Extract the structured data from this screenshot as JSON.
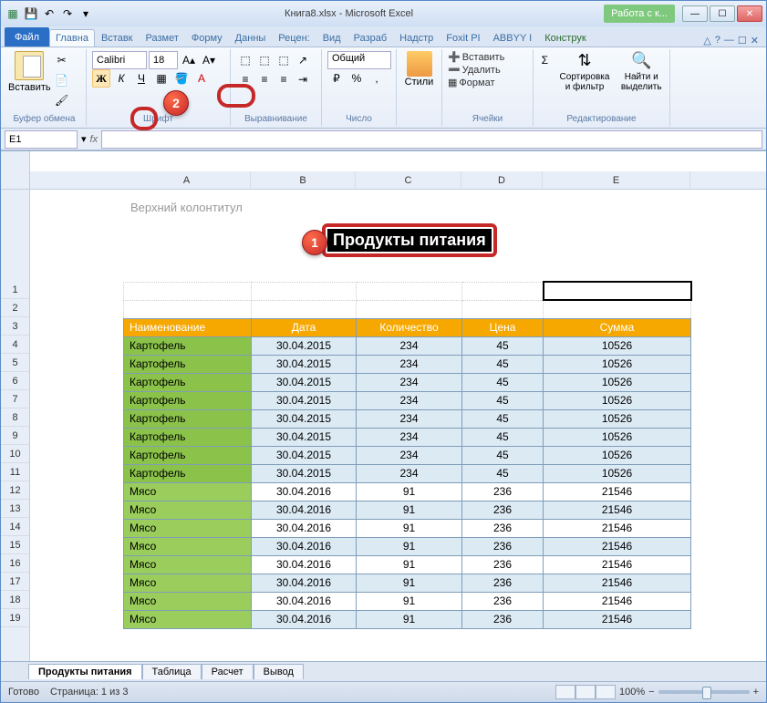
{
  "window": {
    "title": "Книга8.xlsx - Microsoft Excel",
    "context_tab": "Работа с к..."
  },
  "qat": {
    "save": "💾",
    "undo": "↶",
    "redo": "↷"
  },
  "win_btns": {
    "min": "—",
    "max": "☐",
    "close": "✕"
  },
  "ribbon": {
    "tabs": [
      "Файл",
      "Главна",
      "Вставк",
      "Размет",
      "Форму",
      "Данны",
      "Рецен:",
      "Вид",
      "Разраб",
      "Надстр",
      "Foxit PI",
      "ABBYY I",
      "Конструк"
    ],
    "help": {
      "q": "?",
      "up": "△",
      "sub_min": "—",
      "sub_max": "☐",
      "sub_close": "✕"
    },
    "groups": {
      "clipboard": "Буфер обмена",
      "font": "Шрифт",
      "align": "Выравнивание",
      "number": "Число",
      "styles": "Стили",
      "cells": "Ячейки",
      "editing": "Редактирование"
    },
    "paste": "Вставить",
    "font_name": "Calibri",
    "font_size": "18",
    "bold": "Ж",
    "italic": "К",
    "underline": "Ч",
    "number_format": "Общий",
    "cells_insert": "Вставить",
    "cells_delete": "Удалить",
    "cells_format": "Формат",
    "sort": "Сортировка и фильтр",
    "find": "Найти и выделить"
  },
  "namebox": "E1",
  "fx": "fx",
  "cols": [
    "A",
    "B",
    "C",
    "D",
    "E"
  ],
  "rows": [
    "1",
    "2",
    "3",
    "4",
    "5",
    "6",
    "7",
    "8",
    "9",
    "10",
    "11",
    "12",
    "13",
    "14",
    "15",
    "16",
    "17",
    "18",
    "19"
  ],
  "header": {
    "label": "Верхний колонтитул",
    "title": "Продукты питания"
  },
  "table": {
    "headers": [
      "Наименование",
      "Дата",
      "Количество",
      "Цена",
      "Сумма"
    ],
    "rows": [
      {
        "name": "Картофель",
        "date": "30.04.2015",
        "qty": "234",
        "price": "45",
        "sum": "10526",
        "t": "kart"
      },
      {
        "name": "Картофель",
        "date": "30.04.2015",
        "qty": "234",
        "price": "45",
        "sum": "10526",
        "t": "kart"
      },
      {
        "name": "Картофель",
        "date": "30.04.2015",
        "qty": "234",
        "price": "45",
        "sum": "10526",
        "t": "kart"
      },
      {
        "name": "Картофель",
        "date": "30.04.2015",
        "qty": "234",
        "price": "45",
        "sum": "10526",
        "t": "kart"
      },
      {
        "name": "Картофель",
        "date": "30.04.2015",
        "qty": "234",
        "price": "45",
        "sum": "10526",
        "t": "kart"
      },
      {
        "name": "Картофель",
        "date": "30.04.2015",
        "qty": "234",
        "price": "45",
        "sum": "10526",
        "t": "kart"
      },
      {
        "name": "Картофель",
        "date": "30.04.2015",
        "qty": "234",
        "price": "45",
        "sum": "10526",
        "t": "kart"
      },
      {
        "name": "Картофель",
        "date": "30.04.2015",
        "qty": "234",
        "price": "45",
        "sum": "10526",
        "t": "kart"
      },
      {
        "name": "Мясо",
        "date": "30.04.2016",
        "qty": "91",
        "price": "236",
        "sum": "21546",
        "t": "myaso"
      },
      {
        "name": "Мясо",
        "date": "30.04.2016",
        "qty": "91",
        "price": "236",
        "sum": "21546",
        "t": "myaso alt"
      },
      {
        "name": "Мясо",
        "date": "30.04.2016",
        "qty": "91",
        "price": "236",
        "sum": "21546",
        "t": "myaso"
      },
      {
        "name": "Мясо",
        "date": "30.04.2016",
        "qty": "91",
        "price": "236",
        "sum": "21546",
        "t": "myaso alt"
      },
      {
        "name": "Мясо",
        "date": "30.04.2016",
        "qty": "91",
        "price": "236",
        "sum": "21546",
        "t": "myaso"
      },
      {
        "name": "Мясо",
        "date": "30.04.2016",
        "qty": "91",
        "price": "236",
        "sum": "21546",
        "t": "myaso alt"
      },
      {
        "name": "Мясо",
        "date": "30.04.2016",
        "qty": "91",
        "price": "236",
        "sum": "21546",
        "t": "myaso"
      },
      {
        "name": "Мясо",
        "date": "30.04.2016",
        "qty": "91",
        "price": "236",
        "sum": "21546",
        "t": "myaso alt"
      }
    ]
  },
  "sheet_tabs": [
    "Продукты питания",
    "Таблица",
    "Расчет",
    "Вывод"
  ],
  "status": {
    "ready": "Готово",
    "page": "Страница: 1 из 3",
    "zoom": "100%",
    "minus": "−",
    "plus": "+"
  },
  "callouts": {
    "one": "1",
    "two": "2"
  }
}
